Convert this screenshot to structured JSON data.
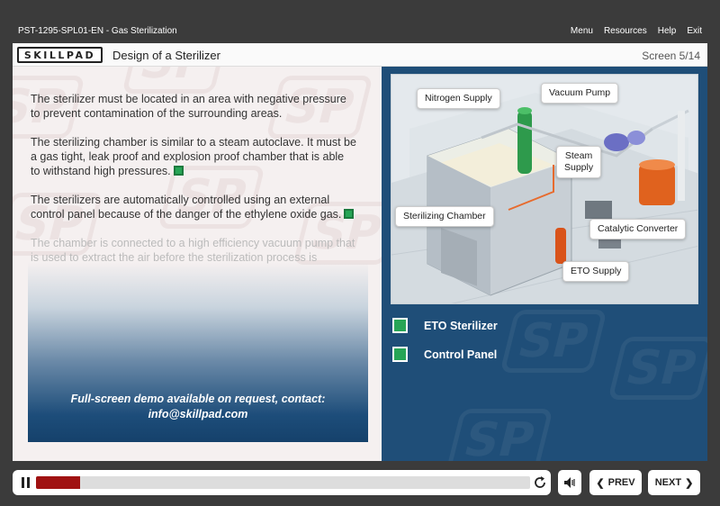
{
  "header": {
    "course_title": "PST-1295-SPL01-EN - Gas Sterilization",
    "menu_items": [
      "Menu",
      "Resources",
      "Help",
      "Exit"
    ]
  },
  "titlebar": {
    "logo_text": "SKILLPAD",
    "page_title": "Design of a Sterilizer",
    "screen_counter": "Screen 5/14"
  },
  "content": {
    "paragraphs": [
      "The sterilizer must be located in an area with negative pressure to prevent contamination of the surrounding areas.",
      "The sterilizing chamber is similar to a steam autoclave. It must be a gas tight, leak proof and explosion proof chamber that is able to withstand high pressures.",
      "The sterilizers are automatically controlled using an external control panel because of the danger of the ethylene oxide gas.",
      "The chamber is connected to a high efficiency vacuum pump that is used to extract the air before the sterilization process is"
    ],
    "demo_message_line1": "Full-screen demo available on request, contact:",
    "demo_message_line2": "info@skillpad.com",
    "watermark_text": "SP"
  },
  "diagram": {
    "callouts": {
      "nitrogen": "Nitrogen Supply",
      "vacuum": "Vacuum Pump",
      "steam_line1": "Steam",
      "steam_line2": "Supply",
      "chamber": "Sterilizing Chamber",
      "catalytic": "Catalytic Converter",
      "eto": "ETO  Supply"
    }
  },
  "options": [
    {
      "label": "ETO Sterilizer"
    },
    {
      "label": "Control Panel"
    }
  ],
  "controls": {
    "progress": 0.09,
    "prev_label": "PREV",
    "next_label": "NEXT"
  },
  "colors": {
    "accent_green": "#27a556",
    "panel_blue": "#1f4e78",
    "progress_red": "#a01212"
  }
}
